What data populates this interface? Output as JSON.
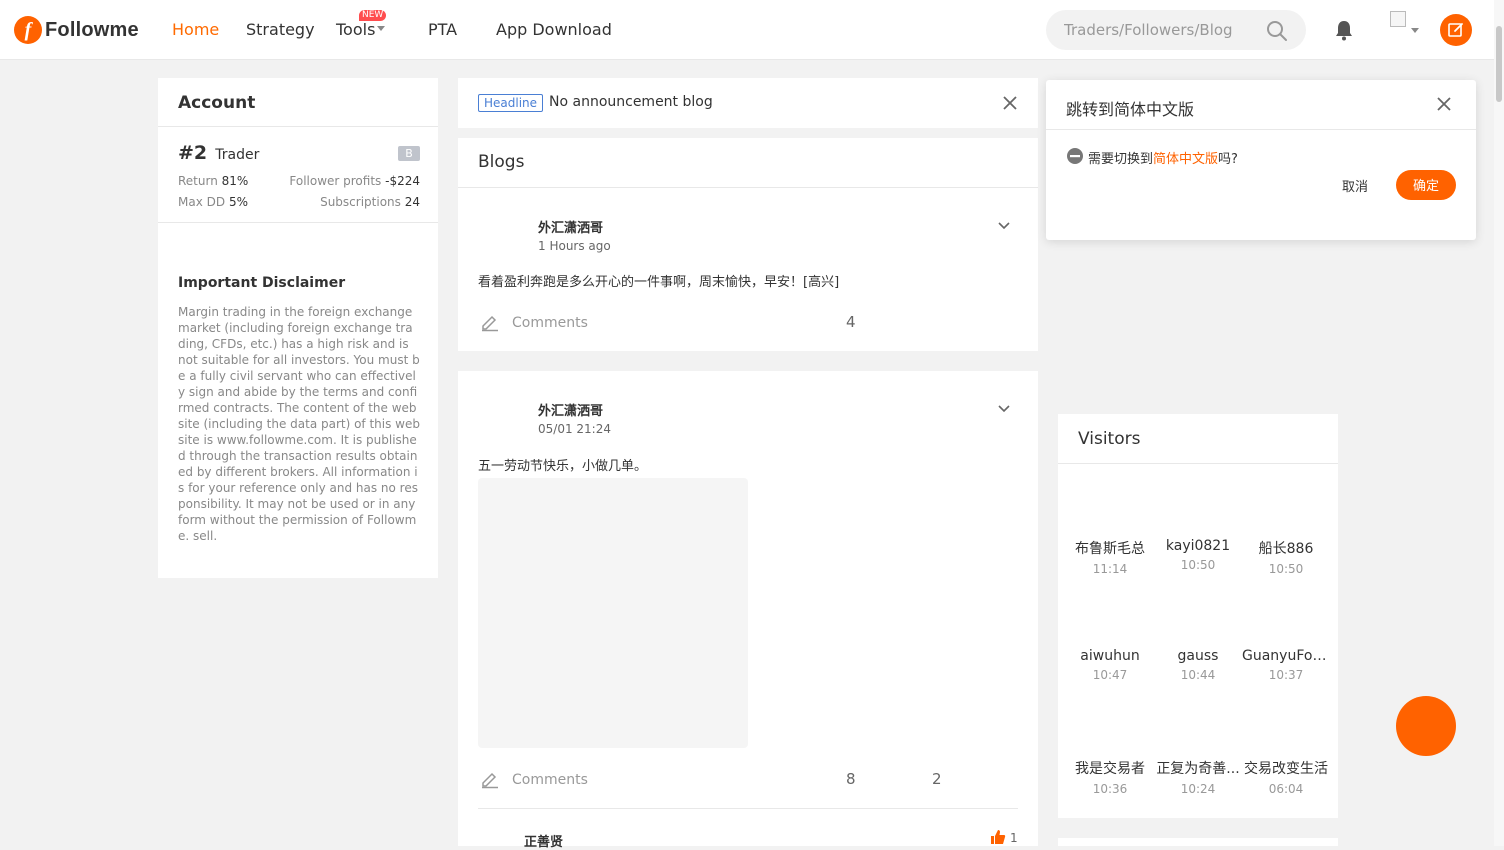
{
  "header": {
    "logo_text": "Followme",
    "nav": [
      "Home",
      "Strategy",
      "Tools",
      "PTA",
      "App Download"
    ],
    "tools_badge": "NEW",
    "search_placeholder": "Traders/Followers/Blog",
    "accent": "#ff6200"
  },
  "account": {
    "title": "Account",
    "rank": "#2",
    "role": "Trader",
    "badge": "B",
    "return_label": "Return",
    "return_value": "81%",
    "follower_profits_label": "Follower profits",
    "follower_profits_value": "-$224",
    "maxdd_label": "Max DD",
    "maxdd_value": "5%",
    "subscriptions_label": "Subscriptions",
    "subscriptions_value": "24",
    "disclaimer_title": "Important Disclaimer",
    "disclaimer_text": "Margin trading in the foreign exchange market (including foreign exchange trading, CFDs, etc.) has a high risk and is not suitable for all investors. You must be a fully civil servant who can effectively sign and abide by the terms and confirmed contracts. The content of the website (including the data part) of this website is www.followme.com. It is published through the transaction results obtained by different brokers. All information is for your reference only and has no responsibility. It may not be used or in any form without the permission of Followme. sell."
  },
  "headline": {
    "tag": "Headline",
    "text": "No announcement blog"
  },
  "blogs": {
    "title": "Blogs",
    "posts": [
      {
        "author": "外汇潇洒哥",
        "time": "1 Hours ago",
        "text": "看着盈利奔跑是多么开心的一件事啊，周末愉快，早安！[高兴]",
        "comments_label": "Comments",
        "count_a": "4",
        "count_b": ""
      },
      {
        "author": "外汇潇洒哥",
        "time": "05/01 21:24",
        "text": "五一劳动节快乐，小做几单。",
        "comments_label": "Comments",
        "count_a": "8",
        "count_b": "2"
      }
    ],
    "reply_author": "正善贤",
    "reply_likes": "1"
  },
  "popup": {
    "title": "跳转到简体中文版",
    "question_prefix": "需要切换到",
    "question_link": "简体中文版",
    "question_suffix": "吗?",
    "cancel": "取消",
    "confirm": "确定"
  },
  "visitors": {
    "title": "Visitors",
    "list": [
      {
        "name": "布鲁斯毛总",
        "time": "11:14"
      },
      {
        "name": "kayi0821",
        "time": "10:50"
      },
      {
        "name": "船长886",
        "time": "10:50"
      },
      {
        "name": "aiwuhun",
        "time": "10:47"
      },
      {
        "name": "gauss",
        "time": "10:44"
      },
      {
        "name": "GuanyuFor...",
        "time": "10:37"
      },
      {
        "name": "我是交易者",
        "time": "10:36"
      },
      {
        "name": "正复为奇善...",
        "time": "10:24"
      },
      {
        "name": "交易改变生活",
        "time": "06:04"
      }
    ]
  }
}
